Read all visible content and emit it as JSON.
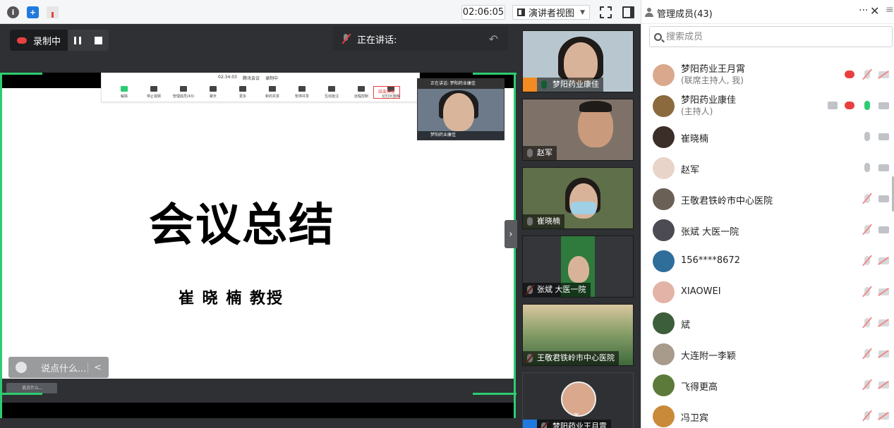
{
  "topbar": {
    "timer": "02:06:05",
    "view_label": "演讲者视图"
  },
  "recording": {
    "label": "录制中"
  },
  "speaking": {
    "label": "正在讲话:"
  },
  "slide": {
    "title": "会议总结",
    "subtitle": "崔 晓 楠  教授",
    "mini_toolbar": {
      "time": "02:34:03",
      "app": "腾讯会议",
      "rec": "录制中",
      "items": [
        "解除",
        "停止视频",
        "管理成员(43)",
        "聊天",
        "更多",
        "新的共享",
        "暂停共享",
        "互动批注",
        "远程控制",
        "幻灯片放映"
      ],
      "end": "结束共享"
    },
    "mini_video": {
      "header": "正在讲话: 梦阳药业康佳",
      "name": "梦阳药业康佳"
    },
    "chat_small": "说点什么..."
  },
  "chat": {
    "placeholder": "说点什么..."
  },
  "video_tiles": [
    {
      "name": "梦阳药业康佳"
    },
    {
      "name": "赵军"
    },
    {
      "name": "崔晓楠"
    },
    {
      "name": "张斌 大医一院"
    },
    {
      "name": "王敬君铁岭市中心医院"
    },
    {
      "name": "梦阳药业王月霄"
    }
  ],
  "panel": {
    "title": "管理成员(43)",
    "more": "···",
    "close": "✕",
    "menu": "≡",
    "search_placeholder": "搜索成员",
    "members": [
      {
        "name": "梦阳药业王月霄",
        "role": "(联席主持人, 我)",
        "avatar": "#d9a88d"
      },
      {
        "name": "梦阳药业康佳",
        "role": "(主持人)",
        "avatar": "#8b6a3e"
      },
      {
        "name": "崔晓楠",
        "role": "",
        "avatar": "#3b2e28"
      },
      {
        "name": "赵军",
        "role": "",
        "avatar": "#e8d4c8"
      },
      {
        "name": "王敬君铁岭市中心医院",
        "role": "",
        "avatar": "#6a6055"
      },
      {
        "name": "张斌 大医一院",
        "role": "",
        "avatar": "#4c4a52"
      },
      {
        "name": "156****8672",
        "role": "",
        "avatar": "#2f6d9a"
      },
      {
        "name": "XIAOWEI",
        "role": "",
        "avatar": "#e2b3a6"
      },
      {
        "name": "斌",
        "role": "",
        "avatar": "#3c5e3a"
      },
      {
        "name": "大连附一李颖",
        "role": "",
        "avatar": "#a99b8b"
      },
      {
        "name": "飞得更高",
        "role": "",
        "avatar": "#5c7a3a"
      },
      {
        "name": "冯卫宾",
        "role": "",
        "avatar": "#c98a3a"
      }
    ]
  }
}
